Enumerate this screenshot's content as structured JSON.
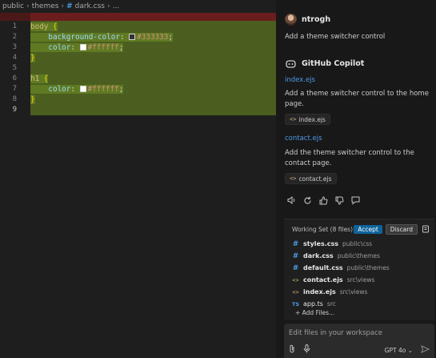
{
  "breadcrumb": {
    "folder1": "public",
    "folder2": "themes",
    "file": "dark.css",
    "more": "..."
  },
  "editor": {
    "line_numbers": [
      "1",
      "2",
      "3",
      "4",
      "5",
      "6",
      "7",
      "8",
      "9"
    ],
    "lines": [
      {
        "selector": "body",
        "brace": " {"
      },
      {
        "property": "background-color",
        "value": "#333333",
        "swatch": "#333333"
      },
      {
        "property": "color",
        "value": "#ffffff",
        "swatch": "#ffffff"
      },
      {
        "brace": "}"
      },
      {},
      {
        "selector": "h1",
        "brace": " {"
      },
      {
        "property": "color",
        "value": "#ffffff",
        "swatch": "#ffffff"
      },
      {
        "brace": "}"
      },
      {}
    ]
  },
  "chat": {
    "user": {
      "name": "ntrogh",
      "message": "Add a theme switcher control"
    },
    "assistant": {
      "name": "GitHub Copilot",
      "changes": [
        {
          "link": "index.ejs",
          "text": "Add a theme switcher control to the home page.",
          "chip": "index.ejs"
        },
        {
          "link": "contact.ejs",
          "text": "Add the theme switcher control to the contact page.",
          "chip": "contact.ejs"
        }
      ]
    },
    "action_icons": [
      "speaker-icon",
      "retry-icon",
      "thumbs-up-icon",
      "thumbs-down-icon",
      "comment-icon"
    ]
  },
  "working_set": {
    "title": "Working Set (8 files)",
    "accept_label": "Accept",
    "discard_label": "Discard",
    "files": [
      {
        "name": "styles.css",
        "path": "public\\css",
        "icon": "hash",
        "bold": true
      },
      {
        "name": "dark.css",
        "path": "public\\themes",
        "icon": "hash",
        "bold": true
      },
      {
        "name": "default.css",
        "path": "public\\themes",
        "icon": "hash",
        "bold": true
      },
      {
        "name": "contact.ejs",
        "path": "src\\views",
        "icon": "code",
        "bold": true
      },
      {
        "name": "index.ejs",
        "path": "src\\views",
        "icon": "code",
        "bold": true
      },
      {
        "name": "app.ts",
        "path": "src",
        "icon": "ts",
        "bold": false
      }
    ],
    "add_files_label": "+ Add Files..."
  },
  "input": {
    "placeholder": "Edit files in your workspace",
    "model": "GPT 4o"
  },
  "colors": {
    "accent": "#0e639c",
    "added_bg": "#4b5e1f",
    "deleted_bg": "#6a1d1d",
    "link": "#4d9be8"
  }
}
